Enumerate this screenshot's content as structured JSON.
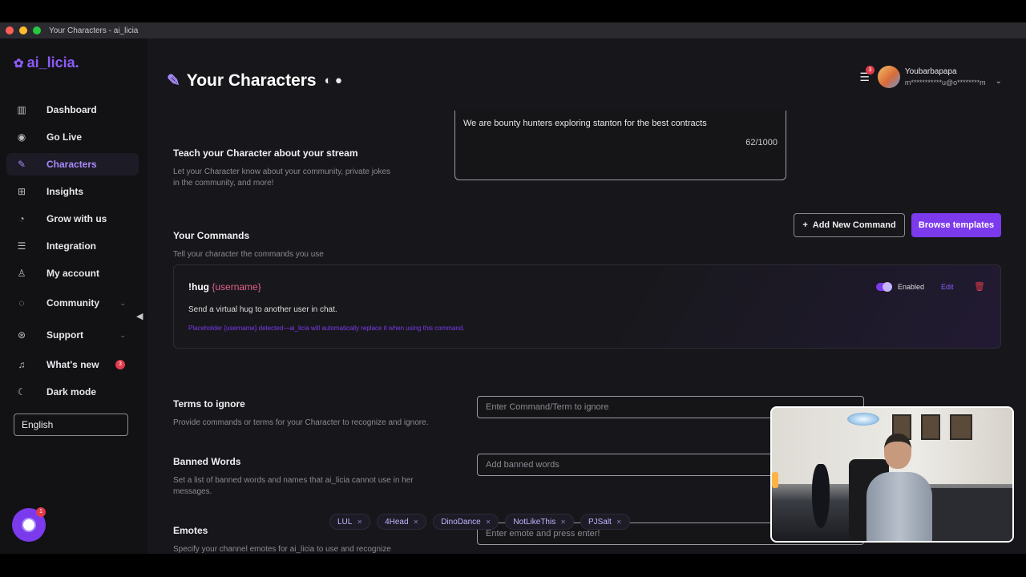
{
  "window": {
    "title": "Your Characters - ai_licia"
  },
  "sidebar": {
    "logo": "ai_licia.",
    "items": [
      {
        "label": "Dashboard",
        "icon": "bar-chart-icon"
      },
      {
        "label": "Go Live",
        "icon": "broadcast-icon"
      },
      {
        "label": "Characters",
        "icon": "character-icon",
        "active": true
      },
      {
        "label": "Insights",
        "icon": "insights-icon"
      },
      {
        "label": "Grow with us",
        "icon": "growth-icon"
      },
      {
        "label": "Integration",
        "icon": "integration-icon"
      },
      {
        "label": "My account",
        "icon": "user-icon"
      },
      {
        "label": "Community",
        "icon": "chat-icon",
        "has_chevron": true
      },
      {
        "label": "Support",
        "icon": "lifebuoy-icon",
        "has_chevron": true
      },
      {
        "label": "What's new",
        "icon": "bell-icon",
        "badge": "3"
      },
      {
        "label": "Dark mode",
        "icon": "moon-icon"
      }
    ],
    "language": "English",
    "chat_badge": "1"
  },
  "header": {
    "title": "Your Characters",
    "notification_count": "3",
    "user_name": "Youbarbapapa",
    "user_email": "m***********u@o********m"
  },
  "stream_section": {
    "title": "Teach your Character about your stream",
    "description": "Let your Character know about your community, private jokes in the community, and more!",
    "value": "We are bounty hunters exploring stanton for the best contracts",
    "counter": "62/1000"
  },
  "commands_section": {
    "title": "Your Commands",
    "description": "Tell your character the commands you use",
    "add_button": "Add New Command",
    "browse_button": "Browse templates",
    "command": {
      "name": "!hug",
      "placeholder": "{username}",
      "description": "Send a virtual hug to another user in chat.",
      "note": "Placeholder {username} detected—ai_licia will automatically replace it when using this command.",
      "status": "Enabled",
      "edit": "Edit"
    }
  },
  "terms_section": {
    "title": "Terms to ignore",
    "description": "Provide commands or terms for your Character to recognize and ignore.",
    "placeholder": "Enter Command/Term to ignore"
  },
  "banned_section": {
    "title": "Banned Words",
    "description": "Set a list of banned words and names that ai_licia cannot use in her messages.",
    "placeholder": "Add banned words"
  },
  "emotes_section": {
    "title": "Emotes",
    "description": "Specify your channel emotes for ai_licia to use and recognize",
    "placeholder": "Enter emote and press enter!",
    "chips": [
      "LUL",
      "4Head",
      "DinoDance",
      "NotLikeThis",
      "PJSalt"
    ]
  },
  "colors": {
    "accent": "#7c3aed",
    "danger": "#e23b4a",
    "background": "#17171b"
  }
}
